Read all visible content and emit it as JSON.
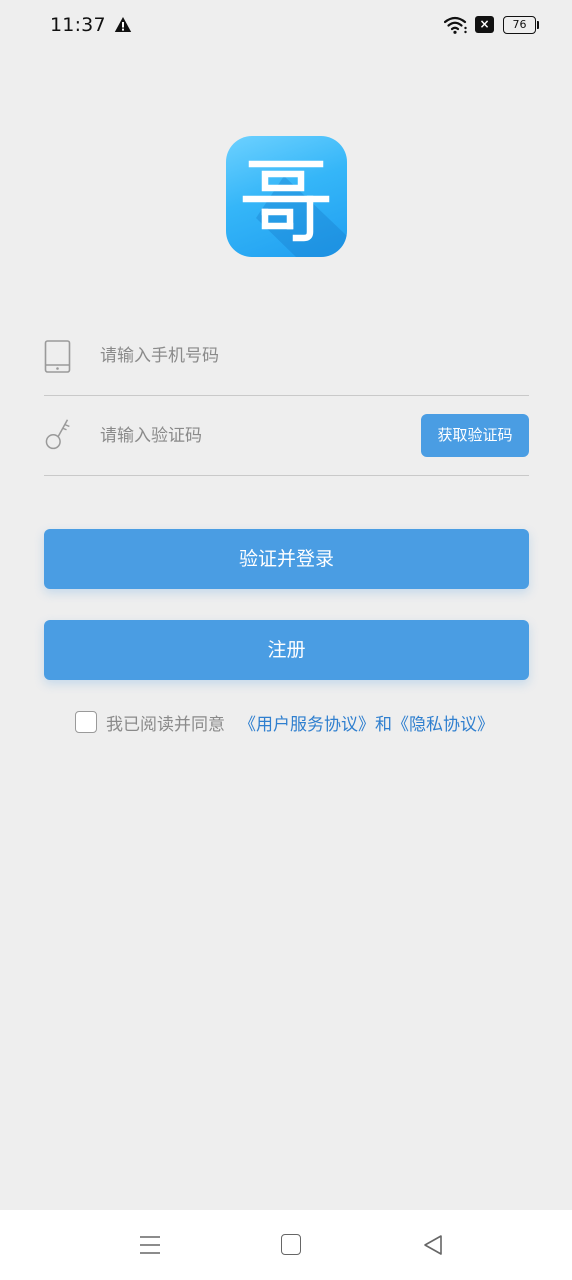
{
  "status_bar": {
    "time": "11:37",
    "sim_label": "×",
    "battery_level": "76"
  },
  "icons": {
    "alert": "warning-triangle-icon",
    "wifi": "wifi-icon",
    "phone": "phone-icon",
    "key": "key-icon"
  },
  "form": {
    "phone_placeholder": "请输入手机号码",
    "phone_value": "",
    "code_placeholder": "请输入验证码",
    "code_value": "",
    "get_code_label": "获取验证码"
  },
  "buttons": {
    "login_label": "验证并登录",
    "register_label": "注册"
  },
  "agreement": {
    "checked": false,
    "text": "我已阅读并同意",
    "service_link": "《用户服务协议》",
    "and": "和",
    "privacy_link": "《隐私协议》"
  },
  "colors": {
    "accent": "#4a9de3",
    "link": "#2f7fcf",
    "background": "#eeeeee"
  }
}
